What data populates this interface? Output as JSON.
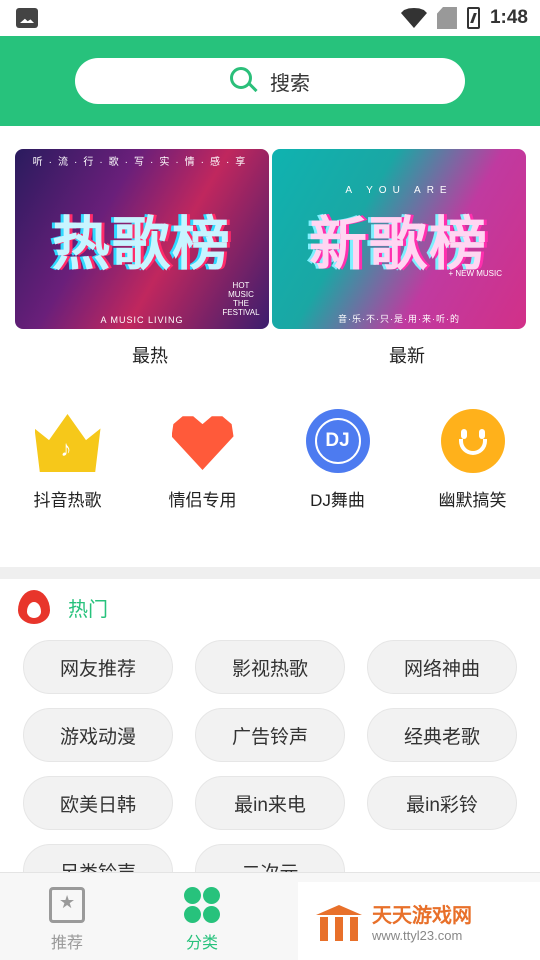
{
  "status_bar": {
    "time": "1:48"
  },
  "search": {
    "label": "搜索"
  },
  "banners": [
    {
      "title": "热歌榜",
      "top_text": "听·流·行·歌·写·实·情·感·享",
      "foot_text": "A MUSIC LIVING",
      "side_text": "HOT MUSIC THE FESTIVAL",
      "caption": "最热"
    },
    {
      "title": "新歌榜",
      "top_text": "A YOU ARE",
      "side_text": "+ NEW MUSIC",
      "foot_text": "音·乐·不·只·是·用·来·听·的",
      "caption": "最新"
    }
  ],
  "categories": [
    {
      "label": "抖音热歌",
      "icon": "crown-note-icon",
      "color": "#f6c81a"
    },
    {
      "label": "情侣专用",
      "icon": "heart-icon",
      "color": "#ff5a3a"
    },
    {
      "label": "DJ舞曲",
      "icon": "dj-icon",
      "icon_text": "DJ",
      "color": "#4d7bf0"
    },
    {
      "label": "幽默搞笑",
      "icon": "smile-icon",
      "color": "#ffb11b"
    }
  ],
  "hot_section": {
    "title": "热门",
    "tags": [
      "网友推荐",
      "影视热歌",
      "网络神曲",
      "游戏动漫",
      "广告铃声",
      "经典老歌",
      "欧美日韩",
      "最in来电",
      "最in彩铃",
      "另类铃声",
      "二次元"
    ]
  },
  "bottom_nav": [
    {
      "label": "推荐",
      "icon": "star-book-icon",
      "active": false
    },
    {
      "label": "分类",
      "icon": "clover-icon",
      "active": true
    }
  ],
  "watermark": {
    "name": "天天游戏网",
    "url": "www.ttyl23.com"
  },
  "colors": {
    "accent": "#27c27c",
    "fire": "#e8352b"
  }
}
